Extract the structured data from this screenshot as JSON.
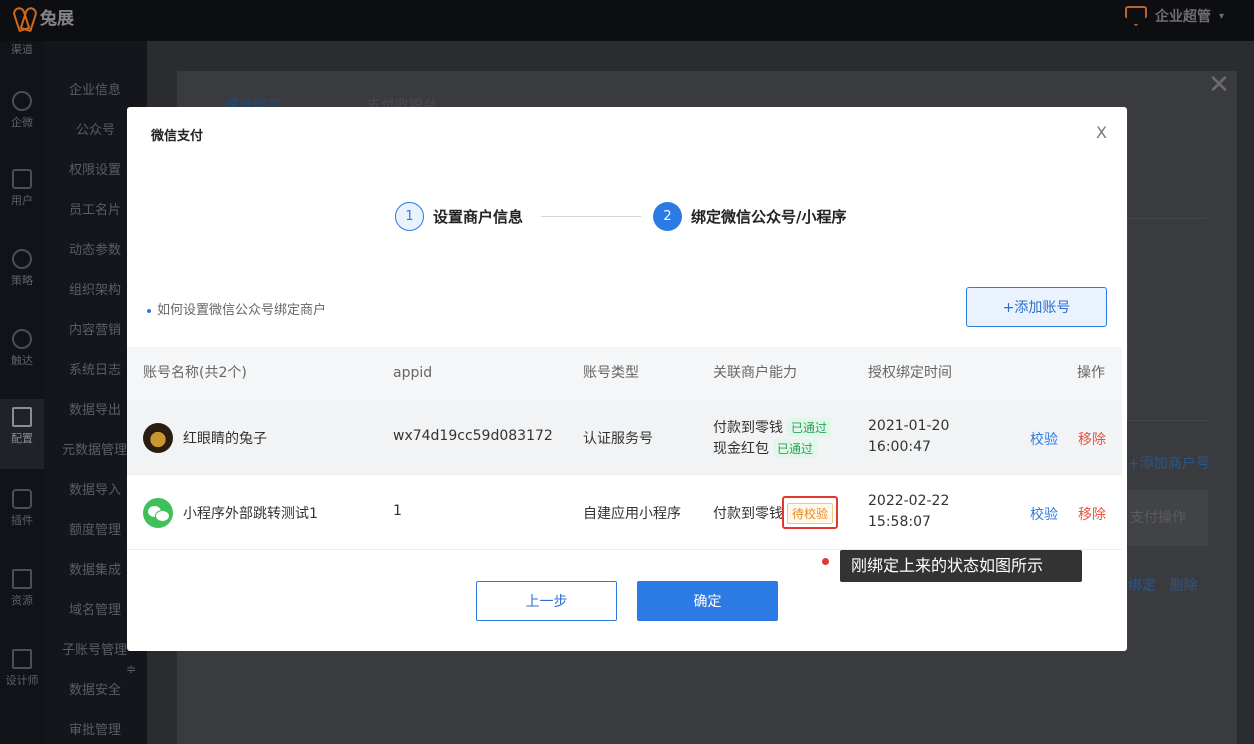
{
  "topbar": {
    "brand": "兔展",
    "user": "企业超管"
  },
  "leftnav": {
    "items": [
      "渠道",
      "企微",
      "用户",
      "策略",
      "触达",
      "配置",
      "插件",
      "资源",
      "设计师"
    ]
  },
  "subnav": {
    "items": [
      "企业信息",
      "公众号",
      "权限设置",
      "员工名片",
      "动态参数",
      "组织架构",
      "内容营销",
      "系统日志",
      "数据导出",
      "元数据管理",
      "数据导入",
      "额度管理",
      "数据集成",
      "域名管理",
      "子账号管理",
      "数据安全",
      "审批管理"
    ]
  },
  "background": {
    "tabs": [
      "渠道绑定",
      "支付收银台"
    ],
    "add_merchant": "+添加商户号",
    "pay_op": "支付操作",
    "unbind": "绑定",
    "delete": "删除"
  },
  "modal": {
    "title": "微信支付",
    "close": "X",
    "steps": [
      {
        "num": "1",
        "label": "设置商户信息"
      },
      {
        "num": "2",
        "label": "绑定微信公众号/小程序"
      }
    ],
    "howto": "如何设置微信公众号绑定商户",
    "add_account": "+添加账号",
    "columns": [
      "账号名称(共2个)",
      "appid",
      "账号类型",
      "关联商户能力",
      "授权绑定时间",
      "操作"
    ],
    "rows": [
      {
        "name": "红眼睛的兔子",
        "appid": "wx74d19cc59d083172",
        "type": "认证服务号",
        "cap1": "付款到零钱",
        "cap1_status": "已通过",
        "cap2": "现金红包",
        "cap2_status": "已通过",
        "date": "2021-01-20",
        "time": "16:00:47",
        "verify": "校验",
        "remove": "移除"
      },
      {
        "name": "小程序外部跳转测试1",
        "appid": "1",
        "type": "自建应用小程序",
        "cap1": "付款到零钱",
        "cap1_status": "待校验",
        "date": "2022-02-22",
        "time": "15:58:07",
        "verify": "校验",
        "remove": "移除"
      }
    ],
    "tooltip": "刚绑定上来的状态如图所示",
    "prev": "上一步",
    "confirm": "确定"
  },
  "colors": {
    "primary": "#2c7be5",
    "danger": "#e8533f",
    "success": "#27a35a",
    "warning": "#ea8a1d"
  }
}
